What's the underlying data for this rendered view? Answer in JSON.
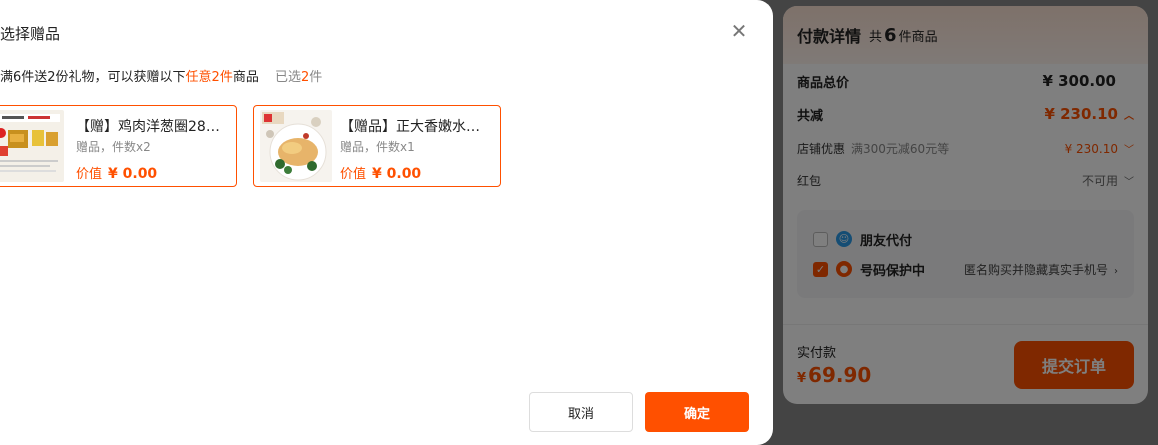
{
  "summary": {
    "title": "付款详情",
    "count_prefix": "共",
    "count_num": "6",
    "count_suffix": "件商品",
    "total_label": "商品总价",
    "total_value": "¥ 300.00",
    "minus_label": "共减",
    "minus_value": "¥ 230.10",
    "shop_label": "店铺优惠",
    "shop_sub": "满300元减60元等",
    "shop_value": "¥ 230.10",
    "redpack_label": "红包",
    "redpack_value": "不可用",
    "friend_pay_label": "朋友代付",
    "privacy_label": "号码保护中",
    "privacy_extra": "匿名购买并隐藏真实手机号",
    "pay_label": "实付款",
    "pay_currency": "¥",
    "pay_amount": "69.90",
    "submit_label": "提交订单"
  },
  "modal": {
    "title": "选择赠品",
    "rule_prefix": "满6件送2份礼物，可以获赠以下",
    "rule_highlight": "任意2件",
    "rule_suffix": "商品",
    "selected_prefix": "已选",
    "selected_num": "2",
    "selected_suffix": "件",
    "cancel_label": "取消",
    "ok_label": "确定",
    "gifts": [
      {
        "name": "【赠】鸡肉洋葱圈28…",
        "meta": "赠品，件数x2",
        "price_label": "价值",
        "price": "¥ 0.00"
      },
      {
        "name": "【赠品】正大香嫩水…",
        "meta": "赠品，件数x1",
        "price_label": "价值",
        "price": "¥ 0.00"
      }
    ]
  },
  "colors": {
    "accent": "#ff5000"
  },
  "icons": {
    "close": "close-icon",
    "friend": "friend-pay-icon",
    "privacy": "privacy-shield-icon"
  }
}
